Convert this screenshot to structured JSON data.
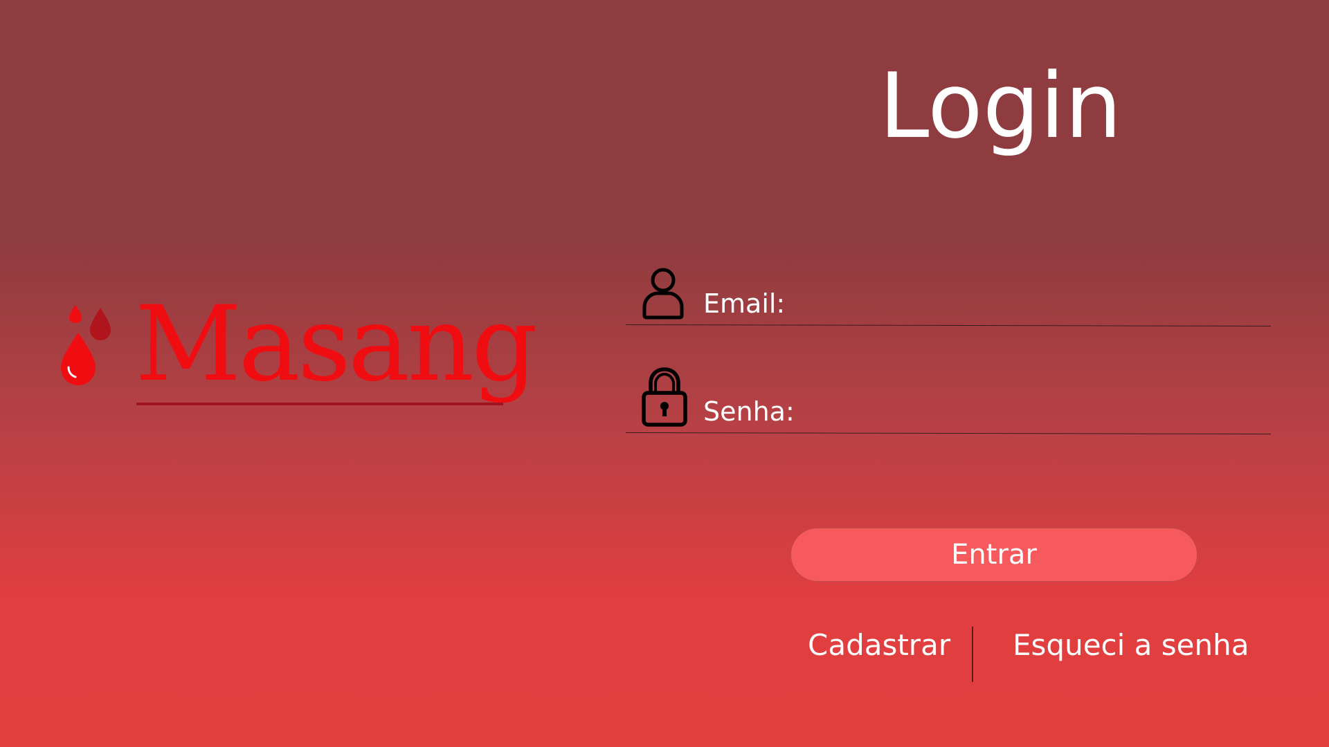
{
  "brand": {
    "name": "Masang",
    "logo_color": "#f00d12",
    "drop_colors": [
      "#f00d12",
      "#b0141c"
    ]
  },
  "login": {
    "title": "Login",
    "email_label": "Email:",
    "email_value": "",
    "email_icon": "user-icon",
    "password_label": "Senha:",
    "password_value": "",
    "password_icon": "lock-icon",
    "submit_label": "Entrar",
    "signup_label": "Cadastrar",
    "forgot_label": "Esqueci a senha"
  },
  "colors": {
    "background_top": "#8e3c3f",
    "background_bottom": "#e23f3f",
    "button": "#f75a5c",
    "text": "#ffffff"
  }
}
